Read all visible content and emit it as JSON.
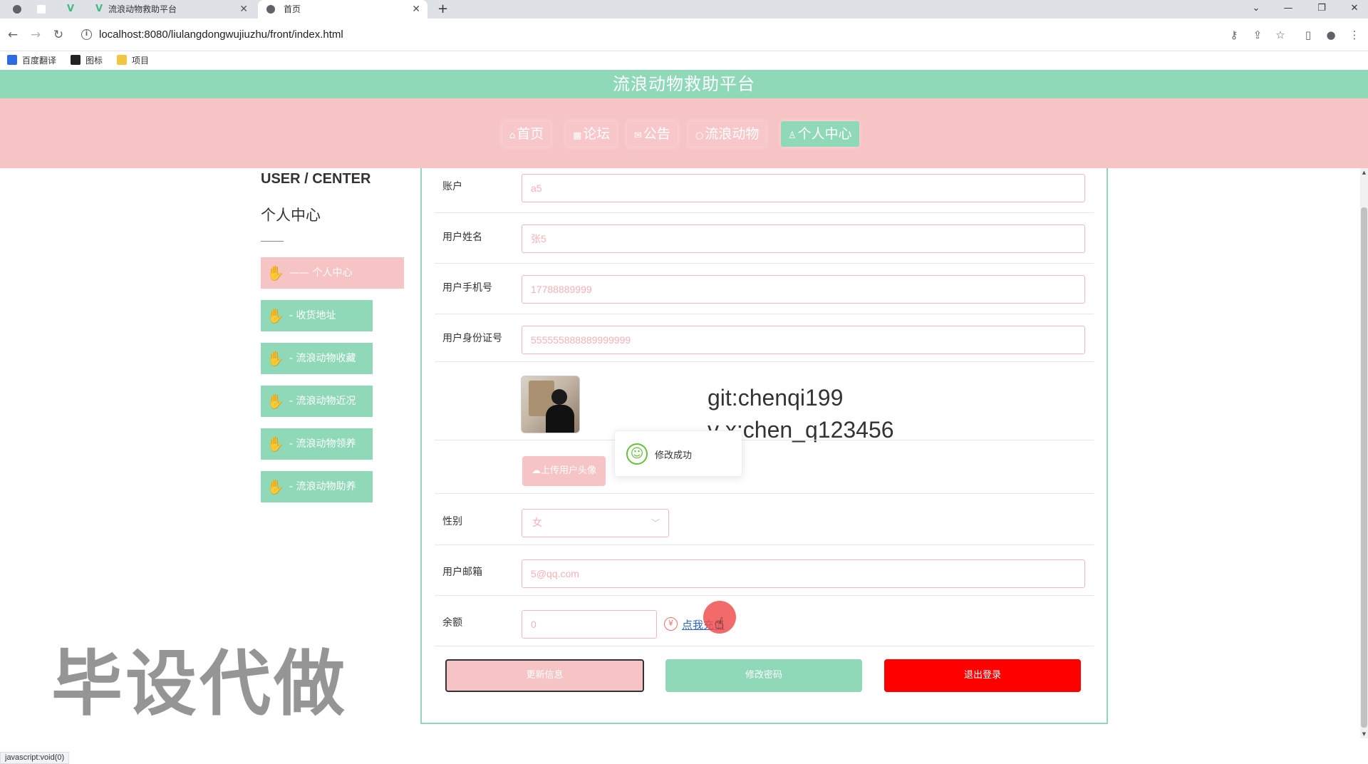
{
  "browser": {
    "tabs": [
      {
        "title": "流浪动物救助平台",
        "active": false
      },
      {
        "title": "首页",
        "active": true
      }
    ],
    "new_tab": "+",
    "url": "localhost:8080/liulangdongwujiuzhu/front/index.html",
    "bookmarks": [
      "百度翻译",
      "图标",
      "项目"
    ],
    "status_text": "javascript:void(0)"
  },
  "site": {
    "title": "流浪动物救助平台",
    "nav": [
      {
        "icon": "home-icon",
        "label": "首页",
        "active": false
      },
      {
        "icon": "forum-icon",
        "label": "论坛",
        "active": false
      },
      {
        "icon": "mail-icon",
        "label": "公告",
        "active": false
      },
      {
        "icon": "pet-icon",
        "label": "流浪动物",
        "active": false
      },
      {
        "icon": "user-icon",
        "label": "个人中心",
        "active": true
      }
    ],
    "colors": {
      "green": "#8fd8b8",
      "pink": "#f7c4c6",
      "red": "#ff0000"
    }
  },
  "sidebar": {
    "title_en": "USER / CENTER",
    "title_cn": "个人中心",
    "items": [
      {
        "label": "—— 个人中心",
        "active": true
      },
      {
        "label": "- 收货地址",
        "active": false
      },
      {
        "label": "- 流浪动物收藏",
        "active": false
      },
      {
        "label": "- 流浪动物近况",
        "active": false
      },
      {
        "label": "- 流浪动物领养",
        "active": false
      },
      {
        "label": "- 流浪动物助养",
        "active": false
      }
    ]
  },
  "form": {
    "account": {
      "label": "账户",
      "value": "a5"
    },
    "name": {
      "label": "用户姓名",
      "value": "张5"
    },
    "phone": {
      "label": "用户手机号",
      "value": "17788889999"
    },
    "id_card": {
      "label": "用户身份证号",
      "value": "555555888889999999"
    },
    "upload_button": "上传用户头像",
    "gender": {
      "label": "性别",
      "value": "女"
    },
    "email": {
      "label": "用户邮箱",
      "value": "5@qq.com"
    },
    "balance": {
      "label": "余额",
      "value": "0",
      "recharge_link": "点我充值"
    },
    "buttons": {
      "update": "更新信息",
      "change_password": "修改密码",
      "logout": "退出登录"
    }
  },
  "toast": {
    "message": "修改成功"
  },
  "overlay": {
    "git": "git:chenqi199",
    "vx": "v x:chen_q123456",
    "watermark": "毕设代做"
  }
}
